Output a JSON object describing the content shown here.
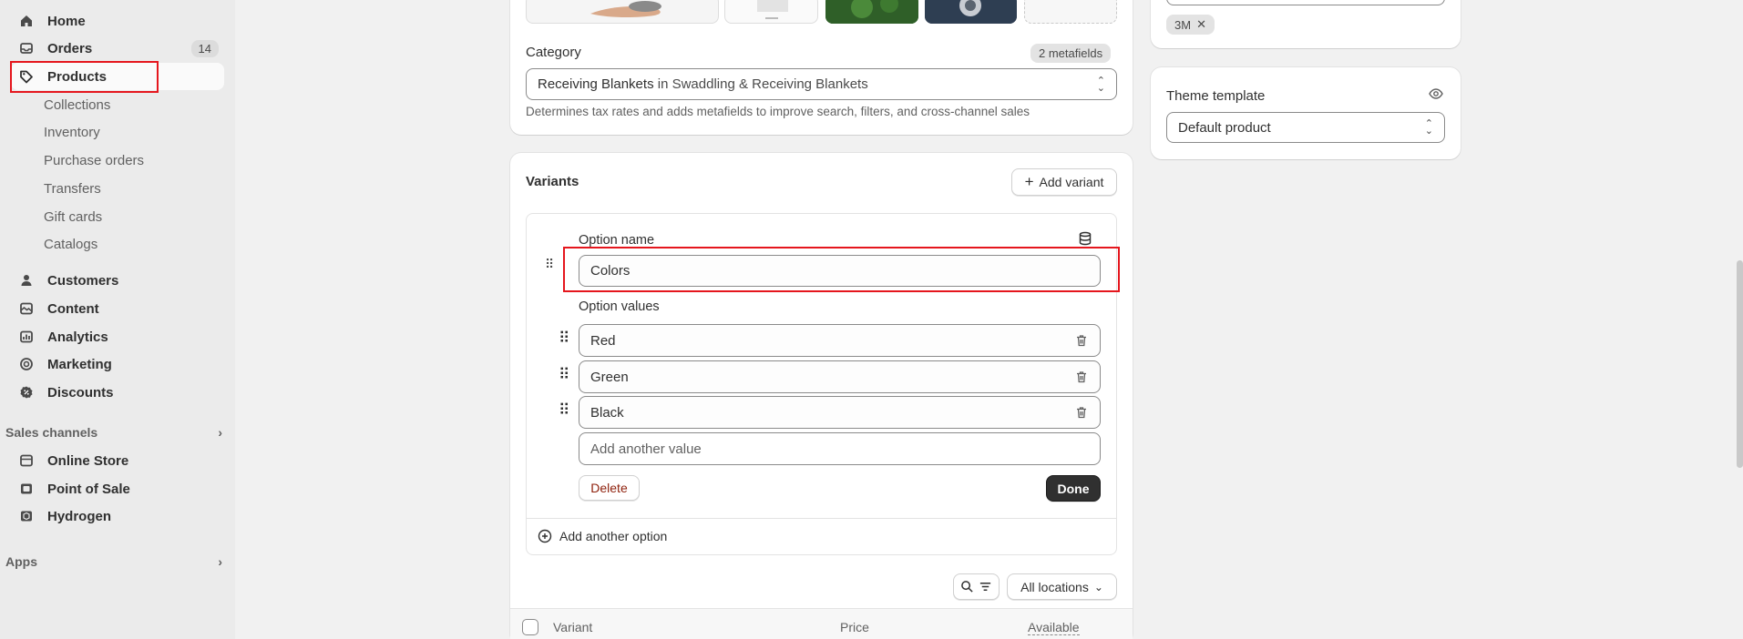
{
  "sidebar": {
    "home": "Home",
    "orders": "Orders",
    "orders_badge": "14",
    "products": "Products",
    "sub_items": [
      "Collections",
      "Inventory",
      "Purchase orders",
      "Transfers",
      "Gift cards",
      "Catalogs"
    ],
    "customers": "Customers",
    "content": "Content",
    "analytics": "Analytics",
    "marketing": "Marketing",
    "discounts": "Discounts",
    "sales_channels": "Sales channels",
    "online_store": "Online Store",
    "point_of_sale": "Point of Sale",
    "hydrogen": "Hydrogen",
    "apps": "Apps"
  },
  "category": {
    "label": "Category",
    "metafields": "2 metafields",
    "value_bold": "Receiving Blankets",
    "value_rest": " in Swaddling & Receiving Blankets",
    "help": "Determines tax rates and adds metafields to improve search, filters, and cross-channel sales"
  },
  "variants": {
    "title": "Variants",
    "add_variant": "Add variant",
    "option_name_label": "Option name",
    "option_name_value": "Colors",
    "option_values_label": "Option values",
    "values": [
      "Red",
      "Green",
      "Black"
    ],
    "add_value_placeholder": "Add another value",
    "delete_label": "Delete",
    "done_label": "Done",
    "add_option": "Add another option",
    "locations": "All locations",
    "table": {
      "variant": "Variant",
      "price": "Price",
      "available": "Available"
    }
  },
  "right": {
    "tag": "3M",
    "theme_label": "Theme template",
    "theme_value": "Default product"
  },
  "colors": {
    "highlight": "#e5161d",
    "sidebar_bg": "#ebebeb",
    "page_bg": "#f1f1f1"
  }
}
